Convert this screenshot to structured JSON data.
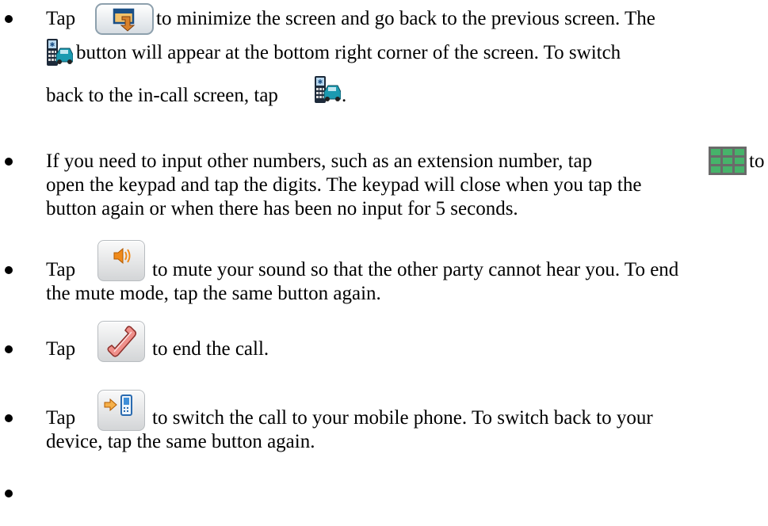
{
  "bullets": [
    {
      "lines": [
        {
          "before": "Tap",
          "after": "to minimize the screen and go back to the previous screen. The"
        },
        {
          "before": "",
          "after": "button will appear at the bottom right corner of the screen. To switch"
        },
        {
          "before": "back to the in-call screen, tap",
          "after": "."
        }
      ]
    },
    {
      "lines": [
        {
          "before": "If you need to input other numbers, such as an extension number, tap",
          "after": "to"
        },
        {
          "before": "open the keypad and tap the digits. The keypad will close when you tap the",
          "after": ""
        },
        {
          "before": "button again or when there has been no input for 5 seconds.",
          "after": ""
        }
      ]
    },
    {
      "lines": [
        {
          "before": "Tap",
          "after": "to mute your sound so that the other party cannot hear you. To end"
        },
        {
          "before": "the mute mode, tap the same button again.",
          "after": ""
        }
      ]
    },
    {
      "lines": [
        {
          "before": "Tap",
          "after": "to end the call."
        }
      ]
    },
    {
      "lines": [
        {
          "before": "Tap",
          "after": "to switch the call to your mobile phone. To switch back to your"
        },
        {
          "before": "device, tap the same button again.",
          "after": ""
        }
      ]
    }
  ],
  "icons": {
    "minimize": "minimize-screen-icon",
    "phone_car": "phone-car-icon",
    "keypad": "keypad-grid-icon",
    "mute": "mute-speaker-icon",
    "end_call": "end-call-handset-icon",
    "switch_phone": "switch-to-mobile-icon"
  }
}
